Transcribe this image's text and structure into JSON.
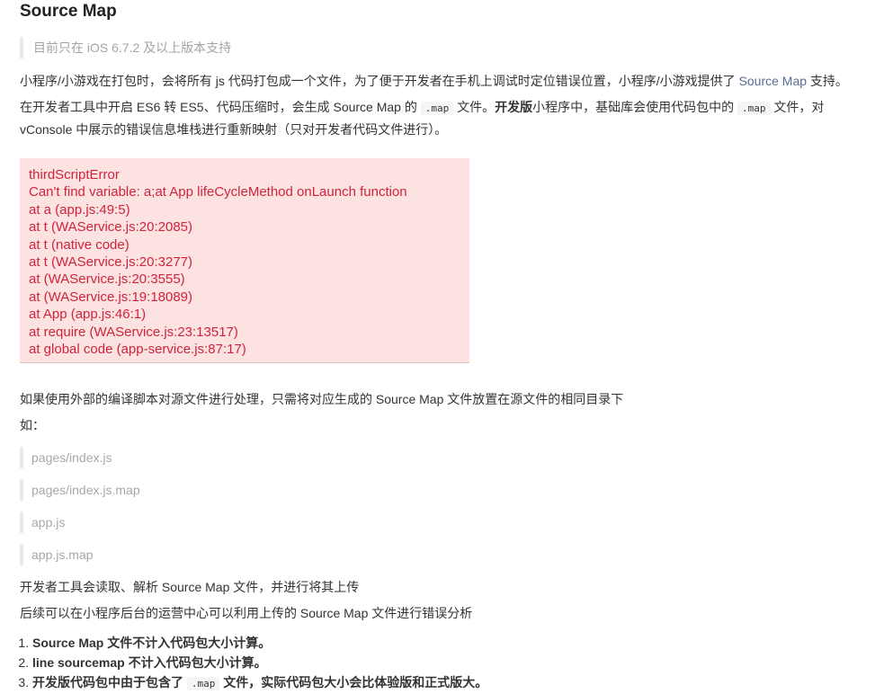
{
  "title": "Source Map",
  "note": "目前只在 iOS 6.7.2 及以上版本支持",
  "intro": {
    "text_before": "小程序/小游戏在打包时，会将所有 js 代码打包成一个文件，为了便于开发者在手机上调试时定位错误位置，小程序/小游戏提供了 ",
    "link": "Source Map",
    "text_after": " 支持。"
  },
  "desc": {
    "part1": "在开发者工具中开启 ES6 转 ES5、代码压缩时，会生成 Source Map 的 ",
    "code1": ".map",
    "part2": " 文件。",
    "bold": "开发版",
    "part3": "小程序中，基础库会使用代码包中的 ",
    "code2": ".map",
    "part4": " 文件，对",
    "line2": "vConsole 中展示的错误信息堆栈进行重新映射（只对开发者代码文件进行）。"
  },
  "error_lines": [
    "thirdScriptError",
    "Can't find variable: a;at App lifeCycleMethod onLaunch function",
    "at a (app.js:49:5)",
    "at t (WAService.js:20:2085)",
    "at t (native code)",
    "at t (WAService.js:20:3277)",
    "at (WAService.js:20:3555)",
    "at (WAService.js:19:18089)",
    "at App (app.js:46:1)",
    "at require (WAService.js:23:13517)",
    "at global code (app-service.js:87:17)"
  ],
  "external_note": "如果使用外部的编译脚本对源文件进行处理，只需将对应生成的 Source Map 文件放置在源文件的相同目录下",
  "example_label": "如：",
  "paths": [
    "pages/index.js",
    "pages/index.js.map",
    "app.js",
    "app.js.map"
  ],
  "upload_note": "开发者工具会读取、解析 Source Map 文件，并进行将其上传",
  "analysis_note": "后续可以在小程序后台的运营中心可以利用上传的 Source Map 文件进行错误分析",
  "list": {
    "item1": "Source Map 文件不计入代码包大小计算。",
    "item2": "line sourcemap 不计入代码包大小计算。",
    "item3_before": "开发版代码包中由于包含了 ",
    "item3_code": ".map",
    "item3_after": " 文件，实际代码包大小会比体验版和正式版大。"
  }
}
